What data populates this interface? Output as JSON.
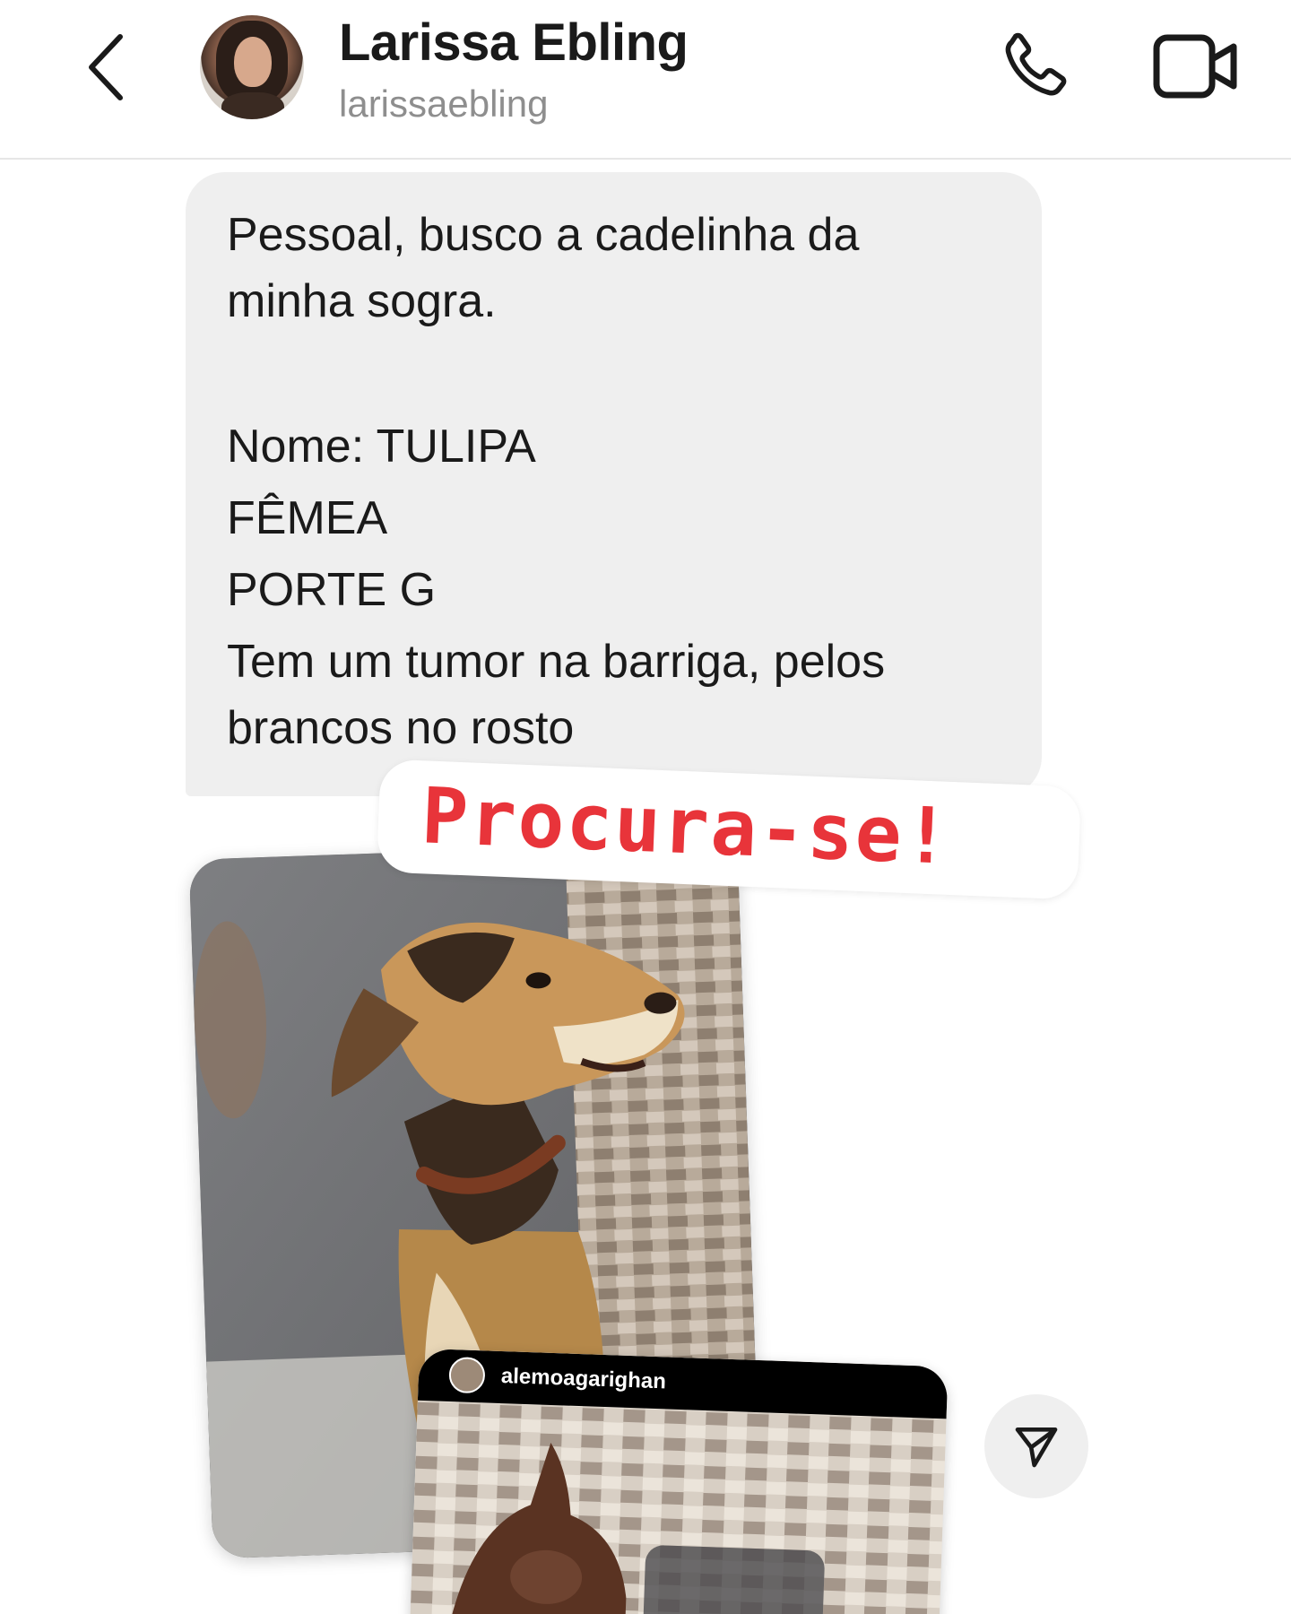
{
  "header": {
    "name": "Larissa Ebling",
    "handle": "larissaebling",
    "icons": {
      "back": "chevron-left-icon",
      "call": "phone-icon",
      "video": "video-camera-icon"
    }
  },
  "message": {
    "lines": [
      "Pessoal, busco a cadelinha da",
      "minha sogra.",
      "Nome: TULIPA",
      "FÊMEA",
      "PORTE G",
      "Tem um tumor na barriga, pelos",
      "brancos no rosto"
    ]
  },
  "sticker": {
    "text": "Procura-se!",
    "color": "#e8343a"
  },
  "shared_story": {
    "username": "alemoagarighan"
  },
  "share": {
    "icon": "send-icon"
  },
  "colors": {
    "bubble": "#efefef",
    "handle": "#8e8e8e",
    "text": "#1a1a1a"
  }
}
